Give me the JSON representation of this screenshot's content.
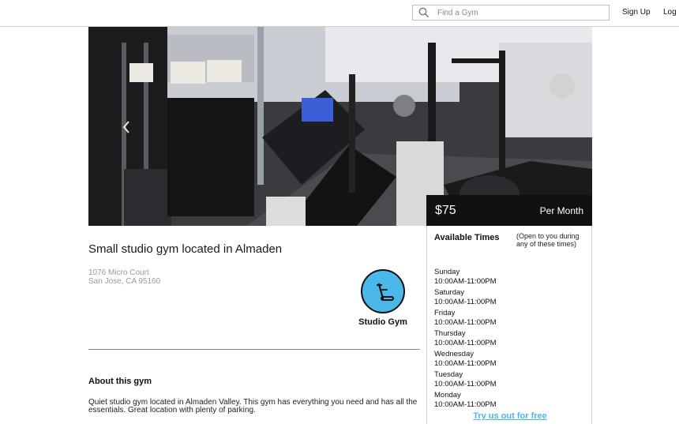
{
  "header": {
    "search_placeholder": "Find a Gym",
    "signup_label": "Sign Up",
    "login_label": "Log In"
  },
  "hero": {
    "price": "$75",
    "period": "Per Month"
  },
  "listing": {
    "title": "Small studio gym located in Almaden",
    "address_line1": "1076 Micro Court",
    "address_line2": "San Jose, CA 95160",
    "badge_label": "Studio Gym",
    "badge_icon": "treadmill-icon",
    "accent_color": "#4ab8e8"
  },
  "about": {
    "heading": "About this gym",
    "text": "Quiet studio gym located in Almaden Valley. This gym has everything you need and has all the essentials. Great location with plenty of parking."
  },
  "availability": {
    "heading": "Available Times",
    "note": "(Open to you during any of these times)",
    "schedule": [
      {
        "day": "Sunday",
        "hours": "10:00AM-11:00PM"
      },
      {
        "day": "Saturday",
        "hours": "10:00AM-11:00PM"
      },
      {
        "day": "Friday",
        "hours": "10:00AM-11:00PM"
      },
      {
        "day": "Thursday",
        "hours": "10:00AM-11:00PM"
      },
      {
        "day": "Wednesday",
        "hours": "10:00AM-11:00PM"
      },
      {
        "day": "Tuesday",
        "hours": "10:00AM-11:00PM"
      },
      {
        "day": "Monday",
        "hours": "10:00AM-11:00PM"
      }
    ],
    "cta": "Try us out for free"
  }
}
